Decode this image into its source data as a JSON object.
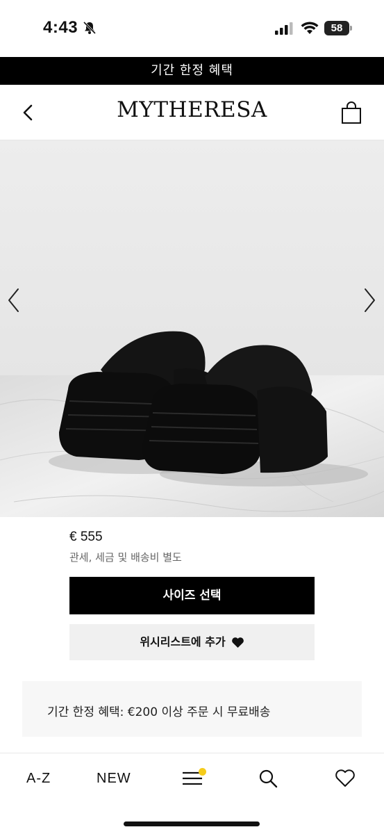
{
  "status_bar": {
    "time": "4:43",
    "battery": "58",
    "icons": [
      "bell-muted-icon",
      "signal-icon",
      "wifi-icon",
      "battery-icon"
    ]
  },
  "promo_banner": {
    "text": "기간 한정 혜택"
  },
  "header": {
    "logo": "MYTHERESA",
    "back_icon": "chevron-left-icon",
    "bag_icon": "shopping-bag-icon"
  },
  "gallery": {
    "prev_icon": "chevron-left-icon",
    "next_icon": "chevron-right-icon"
  },
  "product": {
    "price": "€ 555",
    "tax_note": "관세, 세금 및 배송비 별도"
  },
  "actions": {
    "size_select_label": "사이즈 선택",
    "wishlist_label": "위시리스트에 추가"
  },
  "benefit": {
    "text": "기간 한정 혜택: €200 이상 주문 시 무료배송"
  },
  "bottom_nav": {
    "az_label": "A-Z",
    "new_label": "NEW",
    "menu_icon": "hamburger-menu-icon",
    "search_icon": "search-icon",
    "wishlist_icon": "heart-outline-icon",
    "badge_color": "#f5cc1b"
  }
}
